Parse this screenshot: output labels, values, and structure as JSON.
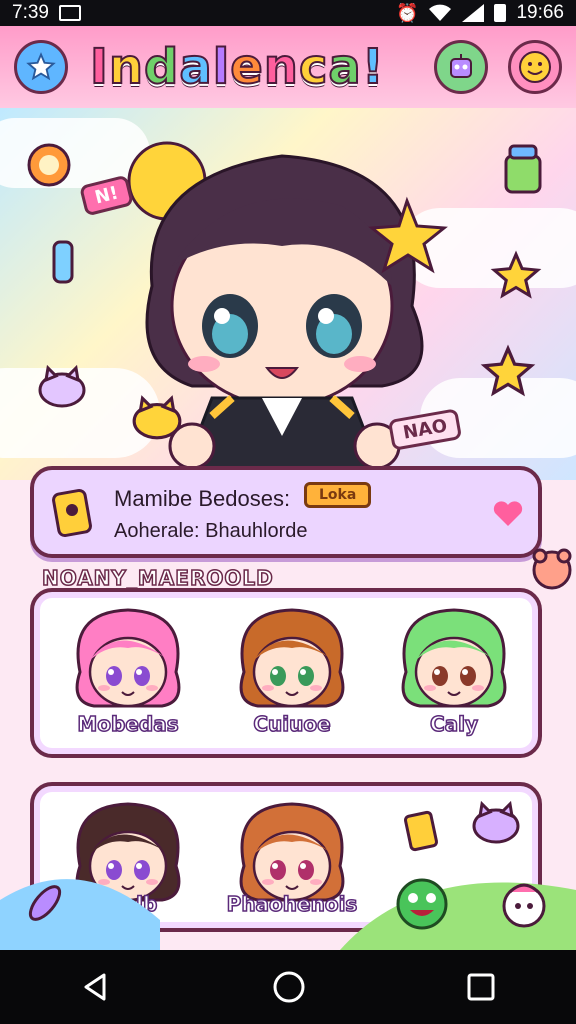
{
  "status": {
    "time": "7:39",
    "clock": "19:66"
  },
  "header": {
    "title": "Indalenca!"
  },
  "hero": {
    "tag_left": "N!",
    "tag_right": "NAO"
  },
  "profile": {
    "line1": "Mamibe Bedoses:",
    "badge": "Loka",
    "line2": "Aoherale: Bhauhlorde"
  },
  "section": {
    "title": "NOANY_MAEROOLD"
  },
  "characters_row1": [
    {
      "name": "Mobedas",
      "hair": "#ff7ec4",
      "eye": "#8a4bd1"
    },
    {
      "name": "Cuiuoe",
      "hair": "#c86a2a",
      "eye": "#3a9a5a"
    },
    {
      "name": "Caly",
      "hair": "#7be07a",
      "eye": "#8a3a2a"
    }
  ],
  "characters_row2": [
    {
      "name": "Stalb",
      "hair": "#4a2a2a",
      "eye": "#8a4bd1"
    },
    {
      "name": "Phaohenois",
      "hair": "#d27038",
      "eye": "#b0306a"
    }
  ],
  "colors": {
    "accent": "#ff6fae",
    "outline": "#6b2a4a",
    "panel_bg": "#ecd5ff"
  }
}
